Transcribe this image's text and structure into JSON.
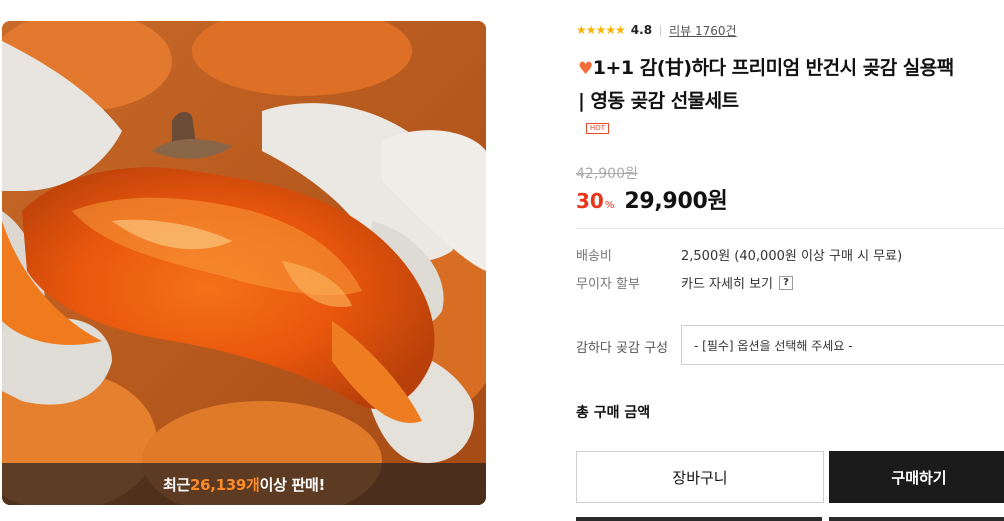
{
  "product_image": {
    "sales_prefix": "최근 ",
    "sales_count": "26,139개",
    "sales_suffix": " 이상 판매!"
  },
  "rating": {
    "stars": "★★★★★",
    "score": "4.8",
    "review_link": "리뷰 1760건"
  },
  "title": {
    "heart": "♥",
    "line1": "1+1 감(甘)하다 프리미엄 반건시 곶감 실용팩",
    "line2": "| 영동 곶감 선물세트"
  },
  "badge": "HOT",
  "price": {
    "original": "42,900원",
    "discount_rate": "30",
    "percent_sign": "%",
    "final": "29,900원"
  },
  "shipping": {
    "label": "배송비",
    "value": "2,500원 (40,000원 이상 구매 시 무료)"
  },
  "installment": {
    "label": "무이자 할부",
    "value": "카드 자세히 보기",
    "help": "?"
  },
  "option": {
    "label": "감하다 곶감 구성",
    "placeholder": "- [필수] 옵션을 선택해 주세요 -"
  },
  "total_label": "총 구매 금액",
  "buttons": {
    "cart": "장바구니",
    "buy": "구매하기"
  },
  "colors": {
    "accent_red": "#e8361c",
    "sales_orange": "#ff8a2a",
    "star_yellow": "#f7b500",
    "buy_button": "#1b1b1b"
  }
}
